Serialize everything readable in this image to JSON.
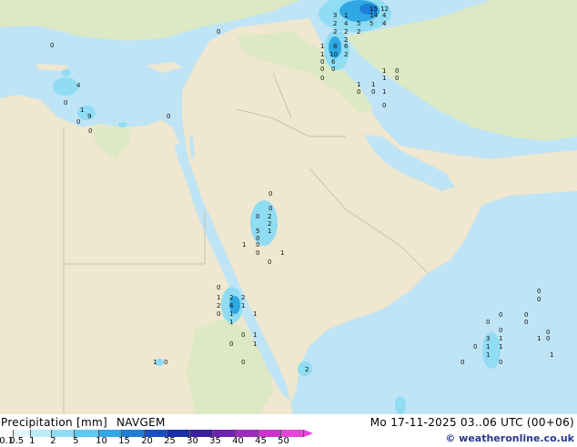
{
  "legend": {
    "title": "Precipitation [mm]",
    "model": "NAVGEM",
    "datetime": "Mo 17-11-2025 03..06 UTC (00+06)",
    "credit": "© weatheronline.co.uk",
    "scale": [
      {
        "label": "0.1",
        "color": "#ffffff"
      },
      {
        "label": "0.5",
        "color": "#e4f7fc"
      },
      {
        "label": "1",
        "color": "#bcebf8"
      },
      {
        "label": "2",
        "color": "#8fdcf3"
      },
      {
        "label": "5",
        "color": "#5ccaee"
      },
      {
        "label": "10",
        "color": "#2fa8e4"
      },
      {
        "label": "15",
        "color": "#1f7ed6"
      },
      {
        "label": "20",
        "color": "#1a4fc4"
      },
      {
        "label": "25",
        "color": "#1b2ea8"
      },
      {
        "label": "30",
        "color": "#3a1fa0"
      },
      {
        "label": "35",
        "color": "#6f22b0"
      },
      {
        "label": "40",
        "color": "#a02ac0"
      },
      {
        "label": "45",
        "color": "#cc33cc"
      },
      {
        "label": "50",
        "color": "#e644d8"
      }
    ]
  },
  "colors": {
    "sea": "#bfe4f5",
    "land_desert": "#efe7cf",
    "land_green": "#dce9c4",
    "precip_light": "#8fdcf3",
    "precip_med": "#2fa8e4",
    "precip_heavy": "#1f7ed6"
  },
  "map_labels": {
    "cyprus": [
      "0",
      "4",
      "0",
      "1",
      "9",
      "0",
      "0",
      "0"
    ],
    "caspian": [
      "3",
      "2",
      "1",
      "15",
      "12",
      "2",
      "4",
      "5",
      "14",
      "4",
      "2",
      "2",
      "5",
      "4",
      "8",
      "2",
      "6",
      "1",
      "1",
      "10",
      "2",
      "0",
      "6",
      "0",
      "0"
    ],
    "iran": [
      "1",
      "0",
      "0",
      "1",
      "1",
      "0",
      "1",
      "0",
      "1",
      "0",
      "0"
    ],
    "hejaz": [
      "0",
      "0",
      "2",
      "0",
      "2",
      "5",
      "1",
      "0",
      "1",
      "0",
      "0",
      "1",
      "0"
    ],
    "eritrea": [
      "0",
      "1",
      "2",
      "2",
      "2",
      "4",
      "1",
      "0",
      "1",
      "1",
      "1",
      "0",
      "0",
      "1",
      "1",
      "0",
      "2"
    ],
    "arabian_sea": [
      "0",
      "0",
      "0",
      "0",
      "0",
      "0",
      "0",
      "3",
      "1",
      "0",
      "1",
      "1",
      "1",
      "0",
      "0",
      "1",
      "1",
      "0",
      "0"
    ],
    "africa": [
      "1",
      "0",
      "0"
    ]
  }
}
